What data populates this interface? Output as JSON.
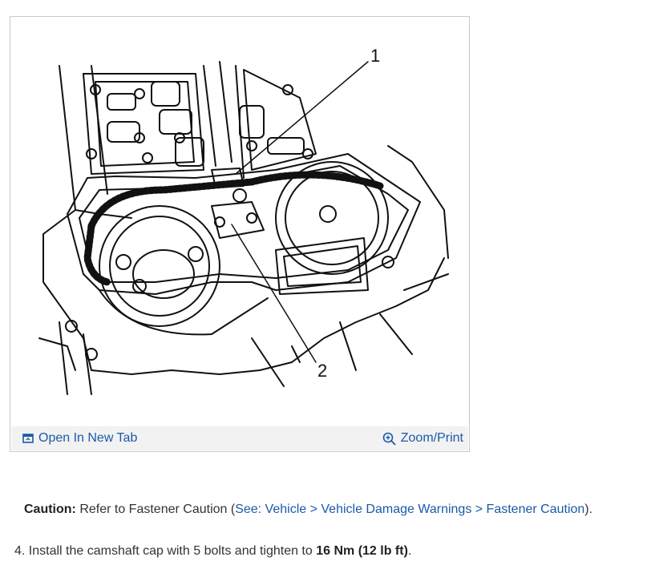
{
  "figure": {
    "callout_1": "1",
    "callout_2": "2",
    "open_tab_label": "Open In New Tab",
    "zoom_label": "Zoom/Print",
    "link_color": "#1a5aa8"
  },
  "caution": {
    "label": "Caution:",
    "text_before": " Refer to Fastener Caution (",
    "link_text": "See: Vehicle > Vehicle Damage Warnings > Fastener Caution",
    "text_after": ")."
  },
  "step": {
    "number": "4.",
    "text": " Install the camshaft cap with 5 bolts and tighten to ",
    "torque": "16 Nm (12 lb ft)",
    "end": "."
  }
}
